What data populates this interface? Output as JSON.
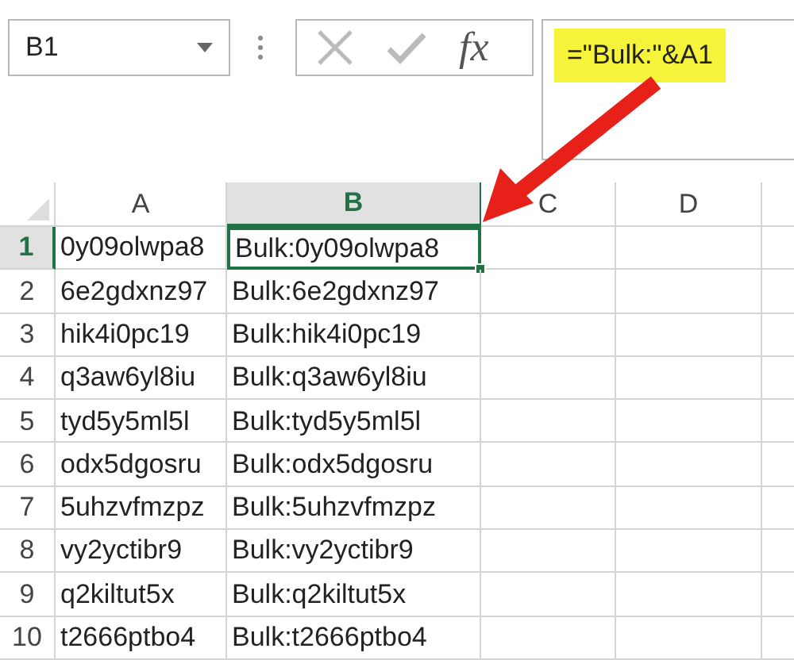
{
  "name_box": {
    "value": "B1"
  },
  "formula_bar": {
    "fx_label": "fx",
    "formula": "=\"Bulk:\"&A1",
    "highlighted": true
  },
  "annotation_arrow": true,
  "columns": [
    {
      "label": "A",
      "selected": false
    },
    {
      "label": "B",
      "selected": true
    },
    {
      "label": "C",
      "selected": false
    },
    {
      "label": "D",
      "selected": false
    }
  ],
  "rows": [
    {
      "label": "1",
      "selected": true,
      "cells": [
        {
          "text": "0y09olwpa8",
          "selected": false
        },
        {
          "text": "Bulk:0y09olwpa8",
          "selected": true
        }
      ]
    },
    {
      "label": "2",
      "selected": false,
      "cells": [
        {
          "text": "6e2gdxnz97",
          "selected": false
        },
        {
          "text": "Bulk:6e2gdxnz97",
          "selected": false
        }
      ]
    },
    {
      "label": "3",
      "selected": false,
      "cells": [
        {
          "text": "hik4i0pc19",
          "selected": false
        },
        {
          "text": "Bulk:hik4i0pc19",
          "selected": false
        }
      ]
    },
    {
      "label": "4",
      "selected": false,
      "cells": [
        {
          "text": "q3aw6yl8iu",
          "selected": false
        },
        {
          "text": "Bulk:q3aw6yl8iu",
          "selected": false
        }
      ]
    },
    {
      "label": "5",
      "selected": false,
      "cells": [
        {
          "text": "tyd5y5ml5l",
          "selected": false
        },
        {
          "text": "Bulk:tyd5y5ml5l",
          "selected": false
        }
      ]
    },
    {
      "label": "6",
      "selected": false,
      "cells": [
        {
          "text": "odx5dgosru",
          "selected": false
        },
        {
          "text": "Bulk:odx5dgosru",
          "selected": false
        }
      ]
    },
    {
      "label": "7",
      "selected": false,
      "cells": [
        {
          "text": "5uhzvfmzpz",
          "selected": false
        },
        {
          "text": "Bulk:5uhzvfmzpz",
          "selected": false
        }
      ]
    },
    {
      "label": "8",
      "selected": false,
      "cells": [
        {
          "text": "vy2yctibr9",
          "selected": false
        },
        {
          "text": "Bulk:vy2yctibr9",
          "selected": false
        }
      ]
    },
    {
      "label": "9",
      "selected": false,
      "cells": [
        {
          "text": "q2kiltut5x",
          "selected": false
        },
        {
          "text": "Bulk:q2kiltut5x",
          "selected": false
        }
      ]
    },
    {
      "label": "10",
      "selected": false,
      "cells": [
        {
          "text": "t2666ptbo4",
          "selected": false
        },
        {
          "text": "Bulk:t2666ptbo4",
          "selected": false
        }
      ]
    }
  ]
}
